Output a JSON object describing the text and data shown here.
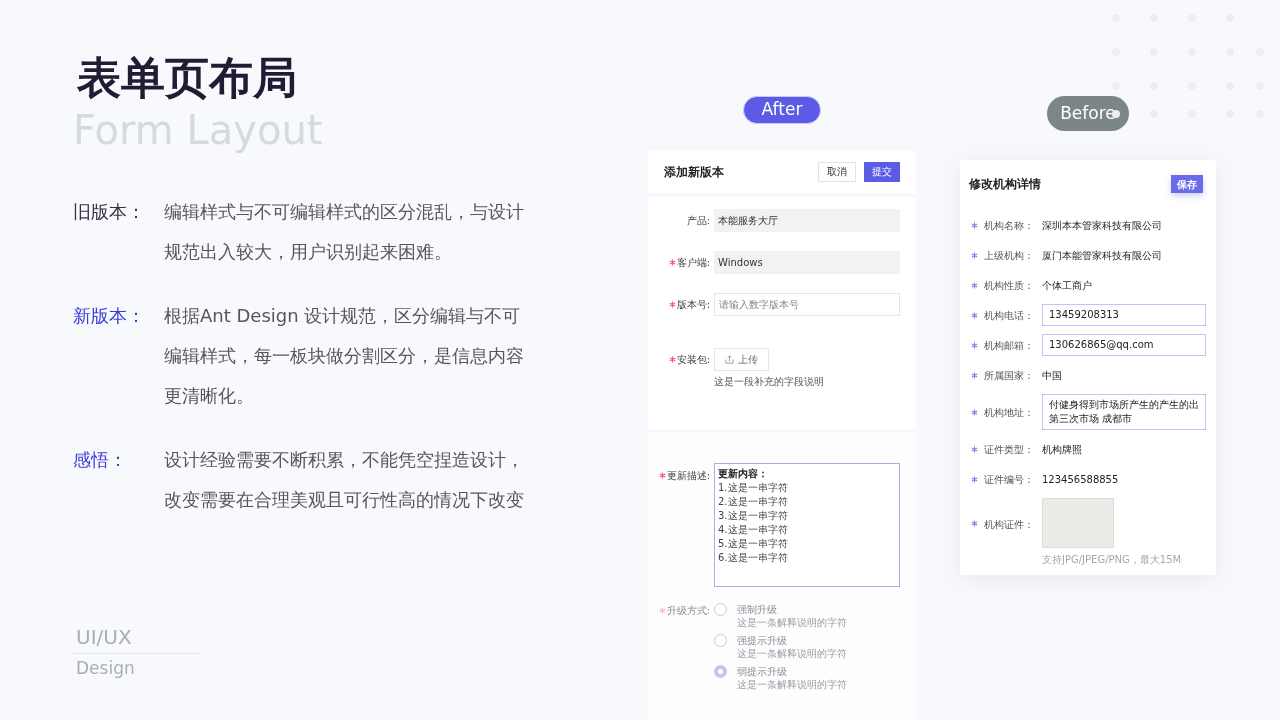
{
  "title": "表单页布局",
  "title_background": "Form Layout",
  "notes": [
    {
      "kind": "old",
      "label": "旧版本：",
      "text": "编辑样式与不可编辑样式的区分混乱，与设计规范出入较大，用户识别起来困难。"
    },
    {
      "kind": "new",
      "label": "新版本：",
      "text": "根据Ant Design 设计规范，区分编辑与不可编辑样式，每一板块做分割区分，是信息内容更清晰化。"
    },
    {
      "kind": "new",
      "label": "感悟：",
      "text": "设计经验需要不断积累，不能凭空捏造设计，改变需要在合理美观且可行性高的情况下改变"
    }
  ],
  "footer": {
    "top": "UI/UX",
    "bottom": "Design"
  },
  "after": {
    "tag": "After",
    "title": "添加新版本",
    "cancel": "取消",
    "submit": "提交",
    "fields": [
      {
        "kind": "readonly",
        "label": "产品:",
        "required": false,
        "value": "本能服务大厅"
      },
      {
        "kind": "readonly",
        "label": "客户端:",
        "required": true,
        "value": "Windows"
      },
      {
        "kind": "input",
        "label": "版本号:",
        "required": true,
        "placeholder": "请输入数字版本号"
      },
      {
        "kind": "upload",
        "label": "安装包:",
        "required": true,
        "button": "上传",
        "hint": "这是一段补充的字段说明"
      }
    ],
    "description": {
      "label": "更新描述:",
      "required": true,
      "lines": [
        "更新内容：",
        "1.这是一串字符",
        "2.这是一串字符",
        "3.这是一串字符",
        "4.这是一串字符",
        "5.这是一串字符",
        "6.这是一串字符"
      ]
    },
    "upgrade": {
      "label": "升级方式:",
      "options": [
        {
          "label": "强制升级",
          "hint": "这是一条解释说明的字符",
          "selected": false
        },
        {
          "label": "强提示升级",
          "hint": "这是一条解释说明的字符",
          "selected": false
        },
        {
          "label": "弱提示升级",
          "hint": "这是一条解释说明的字符",
          "selected": true
        }
      ]
    }
  },
  "before": {
    "tag": "Before",
    "title": "修改机构详情",
    "save": "保存",
    "fields": [
      {
        "kind": "text",
        "label": "机构名称：",
        "value": "深圳本本管家科技有限公司"
      },
      {
        "kind": "text",
        "label": "上级机构：",
        "value": "厦门本能管家科技有限公司"
      },
      {
        "kind": "text",
        "label": "机构性质：",
        "value": "个体工商户"
      },
      {
        "kind": "input",
        "label": "机构电话：",
        "value": "13459208313"
      },
      {
        "kind": "input",
        "label": "机构邮箱：",
        "value": "130626865@qq.com"
      },
      {
        "kind": "text",
        "label": "所属国家：",
        "value": "中国"
      },
      {
        "kind": "input",
        "label": "机构地址：",
        "value": "付健身得到市场所产生的产生的出第三次市场 成都市"
      },
      {
        "kind": "text",
        "label": "证件类型：",
        "value": "机构牌照"
      },
      {
        "kind": "text",
        "label": "证件编号：",
        "value": "123456588855"
      },
      {
        "kind": "image",
        "label": "机构证件：",
        "hint": "支持JPG/JPEG/PNG，最大15M"
      }
    ]
  }
}
